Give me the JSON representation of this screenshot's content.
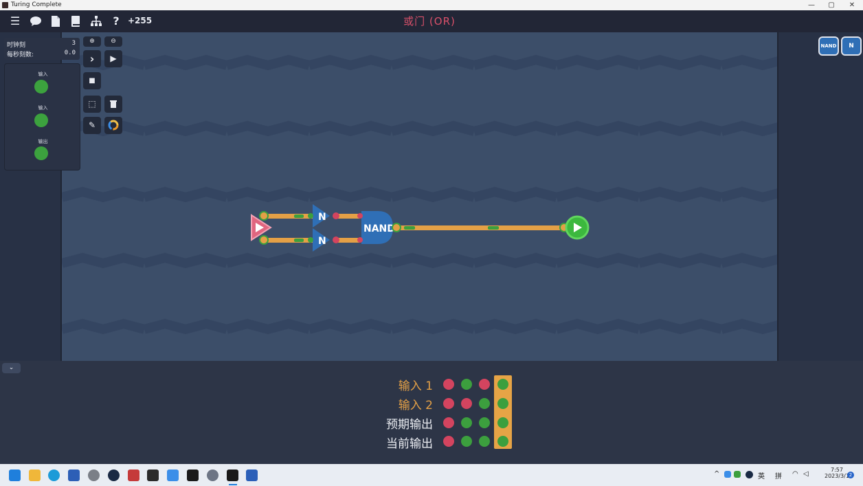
{
  "window": {
    "title": "Turing Complete",
    "minimize": "—",
    "maximize": "▢",
    "close": "✕"
  },
  "toolbar": {
    "menu_icon": "☰",
    "chat_icon": "💬",
    "doc_icon": "🗎",
    "book_icon": "▮",
    "hierarchy_icon": "品",
    "help_icon": "?",
    "score": "+255",
    "level_title": "或门 (OR)"
  },
  "clock": {
    "ticks_label": "时钟刻",
    "ticks_value": "3",
    "tps_label": "每秒刻数:",
    "tps_value": "0.0"
  },
  "io_panel": {
    "items": [
      {
        "label": "输入"
      },
      {
        "label": "输入"
      },
      {
        "label": "输出"
      }
    ]
  },
  "controls": {
    "zoom_in": "⊕",
    "zoom_out": "⊖",
    "step": "›",
    "play": "▶",
    "stop": "■",
    "select": "⬚",
    "delete": "🗑",
    "pencil": "✎",
    "ring": "○"
  },
  "circuit": {
    "nand_label": "NAND",
    "not_label": "N"
  },
  "component_bar": {
    "nand_thumb": "NAND",
    "not_thumb": "N"
  },
  "truth_table": {
    "rows": [
      {
        "label": "输入 1",
        "kind": "input",
        "values": [
          0,
          1,
          0,
          1
        ]
      },
      {
        "label": "输入 2",
        "kind": "input",
        "values": [
          0,
          0,
          1,
          1
        ]
      },
      {
        "label": "预期输出",
        "kind": "output",
        "values": [
          0,
          1,
          1,
          1
        ]
      },
      {
        "label": "当前输出",
        "kind": "output",
        "values": [
          0,
          1,
          1,
          1
        ]
      }
    ],
    "colors": {
      "off": "#d3445f",
      "on": "#3c9f3e",
      "highlight": "#e6a446"
    }
  },
  "taskbar": {
    "tray_ime_1": "英",
    "tray_ime_2": "拼",
    "time": "7:57",
    "date": "2023/3/15",
    "notification_count": "2"
  }
}
